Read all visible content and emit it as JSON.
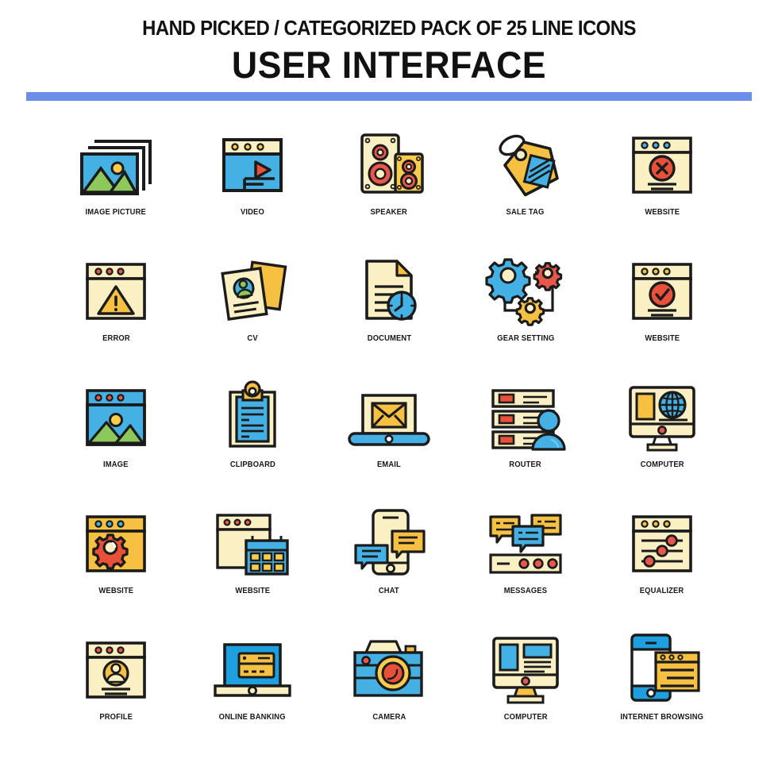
{
  "header": {
    "subtitle_pre": "HAND PICKED / CATEGORIZED PACK OF ",
    "subtitle_count": "25",
    "subtitle_post": " LINE ICONS",
    "title": "USER INTERFACE",
    "rule_color": "#6b8ee8"
  },
  "palette": {
    "outline": "#1b1b1b",
    "cream": "#fbf0c4",
    "yellow": "#f9cc4e",
    "amber": "#f6c042",
    "blue": "#45b0e3",
    "sky": "#3fb3ea",
    "green": "#8cc95a",
    "red": "#e8503a",
    "coral": "#e8574b",
    "white": "#ffffff"
  },
  "icons": [
    {
      "label": "IMAGE PICTURE",
      "name": "image-picture"
    },
    {
      "label": "VIDEO",
      "name": "video"
    },
    {
      "label": "SPEAKER",
      "name": "speaker"
    },
    {
      "label": "SALE TAG",
      "name": "sale-tag"
    },
    {
      "label": "WEBSITE",
      "name": "website-error-cross"
    },
    {
      "label": "ERROR",
      "name": "error"
    },
    {
      "label": "CV",
      "name": "cv"
    },
    {
      "label": "DOCUMENT",
      "name": "document"
    },
    {
      "label": "GEAR SETTING",
      "name": "gear-setting"
    },
    {
      "label": "WEBSITE",
      "name": "website-check"
    },
    {
      "label": "IMAGE",
      "name": "image"
    },
    {
      "label": "CLIPBOARD",
      "name": "clipboard"
    },
    {
      "label": "EMAIL",
      "name": "email"
    },
    {
      "label": "ROUTER",
      "name": "router"
    },
    {
      "label": "COMPUTER",
      "name": "computer-globe"
    },
    {
      "label": "WEBSITE",
      "name": "website-gear"
    },
    {
      "label": "WEBSITE",
      "name": "website-calendar"
    },
    {
      "label": "CHAT",
      "name": "chat"
    },
    {
      "label": "MESSAGES",
      "name": "messages"
    },
    {
      "label": "EQUALIZER",
      "name": "equalizer"
    },
    {
      "label": "PROFILE",
      "name": "profile"
    },
    {
      "label": "ONLINE BANKING",
      "name": "online-banking"
    },
    {
      "label": "CAMERA",
      "name": "camera"
    },
    {
      "label": "COMPUTER",
      "name": "computer-layout"
    },
    {
      "label": "INTERNET BROWSING",
      "name": "internet-browsing"
    }
  ]
}
